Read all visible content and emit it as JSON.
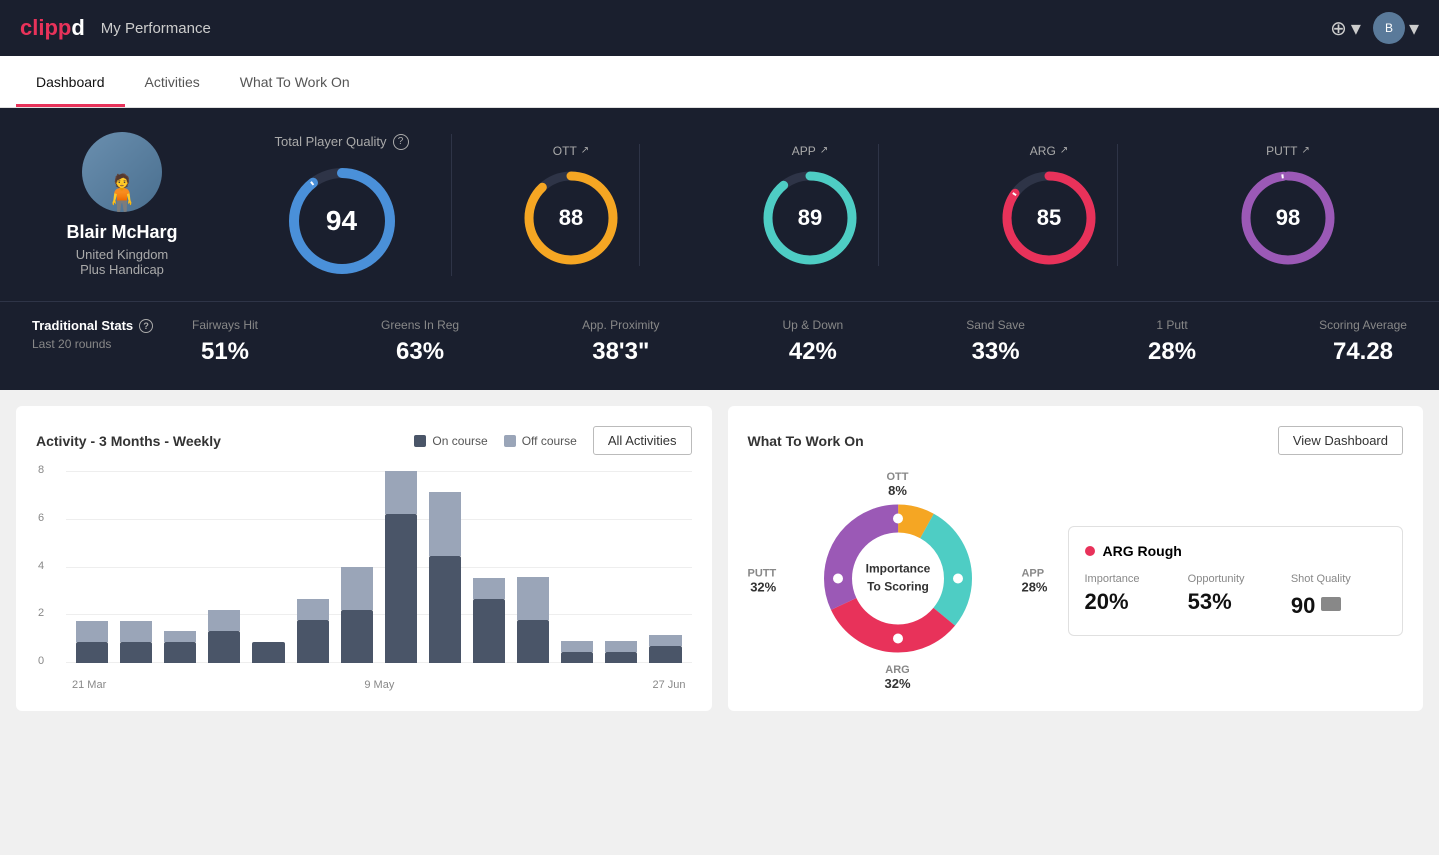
{
  "header": {
    "logo": "clippd",
    "page_title": "My Performance",
    "add_icon": "⊕",
    "user_dropdown": "▾"
  },
  "tabs": [
    {
      "id": "dashboard",
      "label": "Dashboard",
      "active": true
    },
    {
      "id": "activities",
      "label": "Activities",
      "active": false
    },
    {
      "id": "what-to-work-on",
      "label": "What To Work On",
      "active": false
    }
  ],
  "player": {
    "name": "Blair McHarg",
    "country": "United Kingdom",
    "handicap": "Plus Handicap"
  },
  "quality": {
    "title": "Total Player Quality",
    "main_score": "94",
    "categories": [
      {
        "label": "OTT",
        "score": "88",
        "color": "#f5a623",
        "pct": 88
      },
      {
        "label": "APP",
        "score": "89",
        "color": "#4ecdc4",
        "pct": 89
      },
      {
        "label": "ARG",
        "score": "85",
        "color": "#e8325a",
        "pct": 85
      },
      {
        "label": "PUTT",
        "score": "98",
        "color": "#9b59b6",
        "pct": 98
      }
    ]
  },
  "traditional_stats": {
    "title": "Traditional Stats",
    "subtitle": "Last 20 rounds",
    "stats": [
      {
        "name": "Fairways Hit",
        "value": "51%"
      },
      {
        "name": "Greens In Reg",
        "value": "63%"
      },
      {
        "name": "App. Proximity",
        "value": "38'3\""
      },
      {
        "name": "Up & Down",
        "value": "42%"
      },
      {
        "name": "Sand Save",
        "value": "33%"
      },
      {
        "name": "1 Putt",
        "value": "28%"
      },
      {
        "name": "Scoring Average",
        "value": "74.28"
      }
    ]
  },
  "activity_chart": {
    "title": "Activity - 3 Months - Weekly",
    "legend_on": "On course",
    "legend_off": "Off course",
    "button": "All Activities",
    "x_labels": [
      "21 Mar",
      "9 May",
      "27 Jun"
    ],
    "y_labels": [
      "8",
      "6",
      "4",
      "2",
      "0"
    ],
    "bars": [
      {
        "on": 1,
        "off": 1
      },
      {
        "on": 1,
        "off": 1
      },
      {
        "on": 1,
        "off": 0.5
      },
      {
        "on": 1.5,
        "off": 1
      },
      {
        "on": 1,
        "off": 0
      },
      {
        "on": 2,
        "off": 1
      },
      {
        "on": 2.5,
        "off": 2
      },
      {
        "on": 7,
        "off": 2
      },
      {
        "on": 5,
        "off": 3
      },
      {
        "on": 3,
        "off": 1
      },
      {
        "on": 2,
        "off": 2
      },
      {
        "on": 0.5,
        "off": 0.5
      },
      {
        "on": 0.5,
        "off": 0.5
      },
      {
        "on": 0.8,
        "off": 0.5
      }
    ]
  },
  "what_to_work_on": {
    "title": "What To Work On",
    "button": "View Dashboard",
    "donut_center": "Importance\nTo Scoring",
    "segments": [
      {
        "label": "OTT",
        "value": "8%",
        "color": "#f5a623",
        "position": "top"
      },
      {
        "label": "APP",
        "value": "28%",
        "color": "#4ecdc4",
        "position": "right"
      },
      {
        "label": "ARG",
        "value": "32%",
        "color": "#e8325a",
        "position": "bottom"
      },
      {
        "label": "PUTT",
        "value": "32%",
        "color": "#9b59b6",
        "position": "left"
      }
    ],
    "panel": {
      "title": "ARG Rough",
      "dot_color": "#e8325a",
      "cols": [
        {
          "label": "Importance",
          "value": "20%"
        },
        {
          "label": "Opportunity",
          "value": "53%"
        },
        {
          "label": "Shot Quality",
          "value": "90"
        }
      ]
    }
  }
}
